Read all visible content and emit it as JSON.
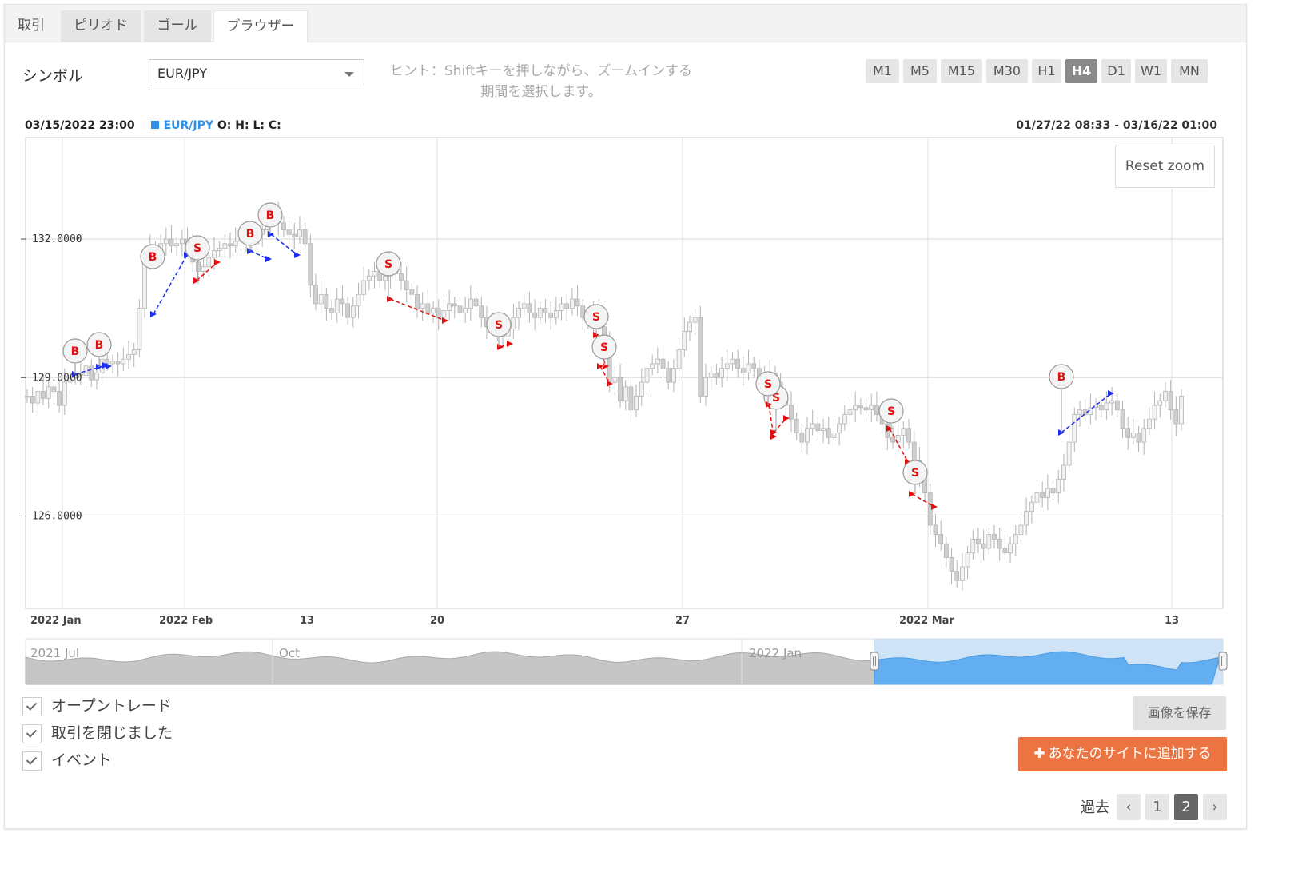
{
  "tabs": [
    "取引",
    "ピリオド",
    "ゴール",
    "ブラウザー"
  ],
  "active_tab": 3,
  "symbol": {
    "label": "シンボル",
    "value": "EUR/JPY"
  },
  "hint": "ヒント：Shiftキーを押しながら、ズームインする期間を選択します。",
  "timeframes": [
    "M1",
    "M5",
    "M15",
    "M30",
    "H1",
    "H4",
    "D1",
    "W1",
    "MN"
  ],
  "active_timeframe": "H4",
  "chart_header": {
    "datetime": "03/15/2022 23:00",
    "symbol": "EUR/JPY",
    "ohlc": "O: H: L: C:",
    "range": "01/27/22 08:33 - 03/16/22 01:00"
  },
  "reset_zoom": "Reset zoom",
  "navigator_labels": [
    "2021 Jul",
    "Oct",
    "2022 Jan"
  ],
  "options": [
    "オープントレード",
    "取引を閉じました",
    "イベント"
  ],
  "save_image": "画像を保存",
  "add_to_site": "あなたのサイトに追加する",
  "pagination": {
    "label": "過去",
    "pages": [
      "1",
      "2"
    ],
    "current": "2"
  },
  "colors": {
    "buy": "#1f2ff0",
    "sell": "#e01010",
    "navigator": "#62aef0",
    "accent": "#ec7442"
  },
  "chart_data": {
    "type": "candlestick",
    "x_tick_labels": [
      "2022 Jan",
      "2022 Feb",
      "13",
      "20",
      "27",
      "2022 Mar",
      "13"
    ],
    "y_tick_labels": [
      "132.0000",
      "129.0000",
      "126.0000"
    ],
    "ylim": [
      124.0,
      134.2
    ],
    "close": [
      128.6,
      128.45,
      128.7,
      128.55,
      128.8,
      128.7,
      128.4,
      128.9,
      129.0,
      129.1,
      129.05,
      129.25,
      128.95,
      129.1,
      129.4,
      129.3,
      129.35,
      129.3,
      129.4,
      129.5,
      129.6,
      130.5,
      131.6,
      131.8,
      131.7,
      131.9,
      132.0,
      131.85,
      131.9,
      132.0,
      131.8,
      131.5,
      131.3,
      131.4,
      131.6,
      131.75,
      131.8,
      131.9,
      131.85,
      131.95,
      132.0,
      132.05,
      131.9,
      132.1,
      132.2,
      132.4,
      132.5,
      132.35,
      132.2,
      132.1,
      132.05,
      132.2,
      131.9,
      131.0,
      130.6,
      130.8,
      130.5,
      130.4,
      130.7,
      130.6,
      130.3,
      130.55,
      130.8,
      131.1,
      131.2,
      131.3,
      131.1,
      131.2,
      131.4,
      131.25,
      131.1,
      130.9,
      130.8,
      130.5,
      130.6,
      130.4,
      130.5,
      130.3,
      130.45,
      130.6,
      130.55,
      130.4,
      130.5,
      130.7,
      130.55,
      130.3,
      130.1,
      130.2,
      130.0,
      129.9,
      130.05,
      130.3,
      130.5,
      130.6,
      130.4,
      130.3,
      130.5,
      130.4,
      130.3,
      130.45,
      130.6,
      130.5,
      130.7,
      130.55,
      130.3,
      130.2,
      130.4,
      130.1,
      129.8,
      128.9,
      129.0,
      128.5,
      128.8,
      128.3,
      128.6,
      128.9,
      129.2,
      129.3,
      129.4,
      129.2,
      128.9,
      129.2,
      129.6,
      130.0,
      130.2,
      130.3,
      128.6,
      129.0,
      129.1,
      129.0,
      129.2,
      129.3,
      129.4,
      129.2,
      129.1,
      129.3,
      129.2,
      129.0,
      128.95,
      129.1,
      128.9,
      128.6,
      128.4,
      128.1,
      127.8,
      127.6,
      127.9,
      128.0,
      127.85,
      127.9,
      127.7,
      127.8,
      128.0,
      128.2,
      128.3,
      128.4,
      128.35,
      128.3,
      128.4,
      128.2,
      128.0,
      127.7,
      127.6,
      127.75,
      127.9,
      127.6,
      127.2,
      126.9,
      126.5,
      125.8,
      125.6,
      125.4,
      125.1,
      124.8,
      124.6,
      124.9,
      125.2,
      125.5,
      125.4,
      125.3,
      125.6,
      125.5,
      125.3,
      125.2,
      125.4,
      125.6,
      125.8,
      126.1,
      126.3,
      126.5,
      126.4,
      126.6,
      126.5,
      126.8,
      127.1,
      127.6,
      128.2,
      128.3,
      128.2,
      128.35,
      128.4,
      128.3,
      128.45,
      128.5,
      128.3,
      127.9,
      127.7,
      127.8,
      127.6,
      127.9,
      128.1,
      128.4,
      128.5,
      128.7,
      128.3,
      128.0,
      128.6
    ]
  }
}
